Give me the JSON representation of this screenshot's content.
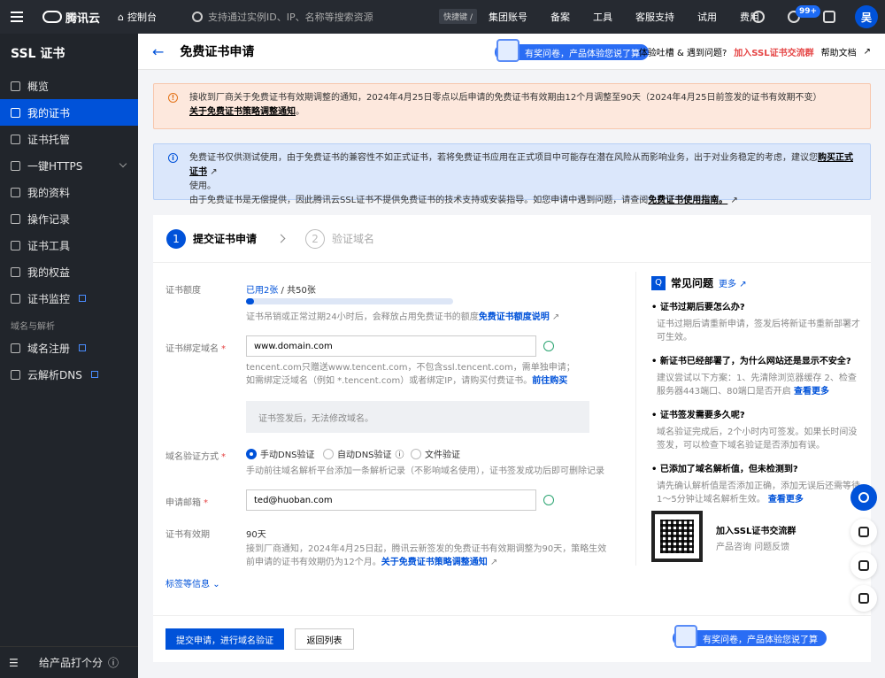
{
  "topbar": {
    "brand": "腾讯云",
    "console": "控制台",
    "search_placeholder": "支持通过实例ID、IP、名称等搜索资源",
    "shortcut": "快捷键 /",
    "nav": [
      "集团账号",
      "备案",
      "工具",
      "客服支持",
      "试用",
      "费用"
    ],
    "notification_badge": "99+",
    "avatar": "吴"
  },
  "sidebar": {
    "title": "SSL 证书",
    "items": [
      {
        "label": "概览",
        "icon": "overview-icon"
      },
      {
        "label": "我的证书",
        "icon": "certificate-icon",
        "active": true
      },
      {
        "label": "证书托管",
        "icon": "hosting-icon"
      },
      {
        "label": "一键HTTPS",
        "icon": "https-icon"
      },
      {
        "label": "我的资料",
        "icon": "folder-icon"
      },
      {
        "label": "操作记录",
        "icon": "record-icon"
      },
      {
        "label": "证书工具",
        "icon": "tool-icon"
      },
      {
        "label": "我的权益",
        "icon": "gift-icon"
      },
      {
        "label": "证书监控",
        "icon": "monitor-icon"
      }
    ],
    "section": "域名与解析",
    "section_items": [
      {
        "label": "域名注册",
        "icon": "domain-icon"
      },
      {
        "label": "云解析DNS",
        "icon": "dns-icon"
      }
    ],
    "footer_rate": "给产品打个分"
  },
  "header": {
    "title": "免费证书申请",
    "survey": "有奖问卷，产品体验您说了算",
    "feedback": "体验吐槽 & 遇到问题?",
    "group_link": "加入SSL证书交流群",
    "help": "帮助文档"
  },
  "notice_warn": {
    "text": "接收到厂商关于免费证书有效期调整的通知，2024年4月25日零点以后申请的免费证书有效期由12个月调整至90天（2024年4月25日前签发的证书有效期不变）",
    "link": "关于免费证书策略调整通知",
    "tail": "。"
  },
  "notice_info": {
    "line1": "免费证书仅供测试使用，由于免费证书的兼容性不如正式证书，若将免费证书应用在正式项目中可能存在潜在风险从而影响业务，出于对业务稳定的考虑，建议您",
    "line1_link": "购买正式证书",
    "line1_tail": "使用。",
    "line2": "由于免费证书是无偿提供，因此腾讯云SSL证书不提供免费证书的技术支持或安装指导。如您申请中遇到问题，请查阅",
    "line2_link": "免费证书使用指南。"
  },
  "steps": [
    {
      "num": "1",
      "label": "提交证书申请"
    },
    {
      "num": "2",
      "label": "验证域名"
    }
  ],
  "form": {
    "quota_label": "证书额度",
    "quota_used": "已用2张",
    "quota_total": " / 共50张",
    "quota_fraction": 0.04,
    "quota_hint": "证书吊销或正常过期24小时后，会释放占用免费证书的额度",
    "quota_link": "免费证书额度说明",
    "domain_label": "证书绑定域名",
    "domain_value": "www.domain.com",
    "domain_hint1": "tencent.com只赠送www.tencent.com，不包含ssl.tencent.com，需单独申请；",
    "domain_hint2": "如需绑定泛域名（例如 *.tencent.com）或者绑定IP，请购买付费证书。",
    "domain_link": "前往购买",
    "disabled_note": "证书签发后，无法修改域名。",
    "verify_label": "域名验证方式",
    "verify_options": [
      "手动DNS验证",
      "自动DNS验证",
      "文件验证"
    ],
    "verify_hint": "手动前往域名解析平台添加一条解析记录（不影响域名使用），证书签发成功后即可删除记录",
    "email_label": "申请邮箱",
    "email_value": "ted@huoban.com",
    "validity_label": "证书有效期",
    "validity_value": "90天",
    "validity_hint1": "接到厂商通知，2024年4月25日起，腾讯云新签发的免费证书有效期调整为90天，策略生效",
    "validity_hint2": "前申请的证书有效期仍为12个月。",
    "validity_link": "关于免费证书策略调整通知",
    "tags_more": "标签等信息",
    "submit": "提交申请，进行域名验证",
    "back": "返回列表"
  },
  "faq": {
    "title": "常见问题",
    "more": "更多",
    "items": [
      {
        "q": "证书过期后要怎么办?",
        "a": "证书过期后请重新申请，签发后将新证书重新部署才可生效。",
        "link": ""
      },
      {
        "q": "新证书已经部署了，为什么网站还是显示不安全?",
        "a": "建议尝试以下方案：1、先清除浏览器缓存 2、检查服务器443端口、80端口是否开启",
        "link": "查看更多"
      },
      {
        "q": "证书签发需要多久呢?",
        "a": "域名验证完成后，2个小时内可签发。如果长时间没签发，可以检查下域名验证是否添加有误。",
        "link": ""
      },
      {
        "q": "已添加了域名解析值，但未检测到?",
        "a": "请先确认解析值是否添加正确，添加无误后还需等待1～5分钟让域名解析生效。",
        "link": "查看更多"
      }
    ],
    "qr_title": "加入SSL证书交流群",
    "qr_sub": "产品咨询 问题反馈"
  },
  "footer_survey": "有奖问卷，产品体验您说了算"
}
